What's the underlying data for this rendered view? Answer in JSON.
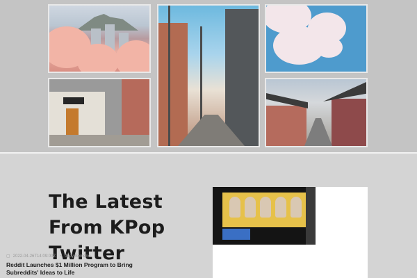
{
  "section": {
    "title": "The Latest From KPop Twitter"
  },
  "gallery": {
    "photos": [
      {
        "subject": "cherry blossoms over city"
      },
      {
        "subject": "narrow street with utility poles"
      },
      {
        "subject": "cherry blossom tree"
      },
      {
        "subject": "storefront street corner"
      },
      {
        "subject": "hanok village alley"
      }
    ]
  },
  "card": {
    "date": "2022-04-26T14:09:00Z",
    "author": "Judy Semeno",
    "headline": "Reddit Launches $1 Million Program to Bring Subreddits' Ideas to Life"
  },
  "icons": {
    "date": "calendar-icon",
    "author": "user-icon"
  },
  "colors": {
    "page_background": "#d4d4d4",
    "gallery_background": "#c4c4c4",
    "title_text": "#1c1c1c"
  }
}
